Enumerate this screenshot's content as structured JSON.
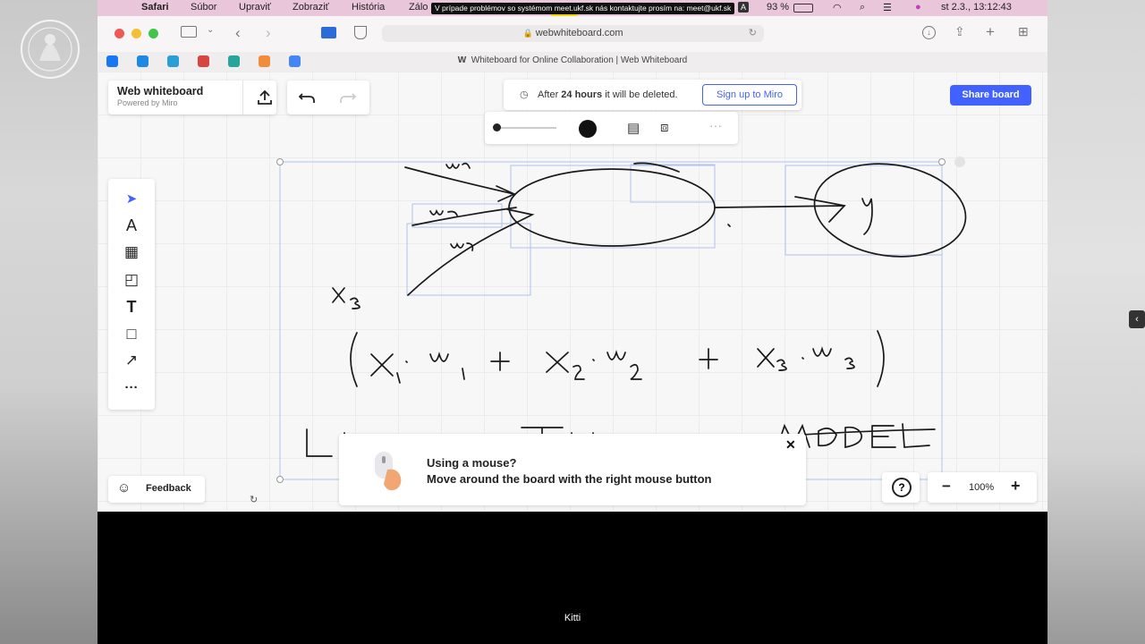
{
  "menubar": {
    "app": "Safari",
    "items": [
      "Súbor",
      "Upraviť",
      "Zobraziť",
      "História",
      "Zálo"
    ],
    "notice": "V prípade problémov so systémom meet.ukf.sk nás kontaktujte prosím na: meet@ukf.sk",
    "hand_count": "1",
    "input_badge": "A",
    "battery": "93 %",
    "datetime": "st 2.3.,  13:12:43"
  },
  "browser": {
    "url": "webwhiteboard.com",
    "tab_title": "Whiteboard for Online Collaboration | Web Whiteboard",
    "tab_logo": "W",
    "favorites": [
      {
        "name": "facebook",
        "color": "#1877f2"
      },
      {
        "name": "messenger",
        "color": "#1e88e5"
      },
      {
        "name": "paypal",
        "color": "#2a9fd6"
      },
      {
        "name": "red-bookmark",
        "color": "#d64541"
      },
      {
        "name": "teal-bookmark",
        "color": "#26a69a"
      },
      {
        "name": "orange-bookmark",
        "color": "#f08c3a"
      },
      {
        "name": "google",
        "color": "#4285f4"
      }
    ]
  },
  "app": {
    "brand_title": "Web whiteboard",
    "brand_sub": "Powered by Miro",
    "notice_pre": "After ",
    "notice_bold": "24 hours",
    "notice_post": " it will be deleted.",
    "signup": "Sign up to Miro",
    "share": "Share board",
    "feedback": "Feedback",
    "zoom": "100%",
    "tip_title": "Using a mouse?",
    "tip_body": "Move around the board with the right mouse button",
    "accent": "#4262ff"
  },
  "tools": [
    "select-tool",
    "pen-tool",
    "template-tool",
    "sticky-note-tool",
    "text-tool",
    "shape-tool",
    "arrow-tool",
    "more-tools"
  ],
  "drawing": {
    "labels": [
      "w1",
      "w2",
      "w3",
      "x3",
      "y"
    ],
    "formula": [
      "(",
      "x1",
      "·",
      "w1",
      "+",
      "x2",
      "·",
      "w2",
      "+",
      "x3",
      "·",
      "w3",
      ")"
    ],
    "heading": "LINEAR THRESHOLD MODEL"
  },
  "subtitle": "Kitti"
}
